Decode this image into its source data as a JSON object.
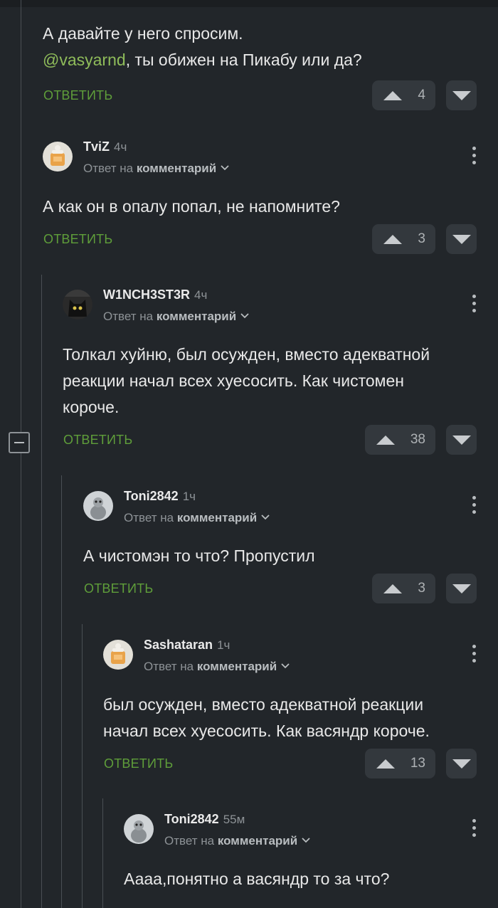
{
  "labels": {
    "reply": "ОТВЕТИТЬ",
    "reply_to": "Ответ на",
    "comment": "комментарий"
  },
  "comments": [
    {
      "body_lines": [
        "А давайте у него спросим."
      ],
      "mention": "@vasyarnd",
      "mention_tail": ", ты обижен на Пикабу или да?",
      "votes": "4"
    },
    {
      "author": "TviZ",
      "time": "4ч",
      "body": "А как он в опалу попал, не напомните?",
      "votes": "3"
    },
    {
      "author": "W1NCH3ST3R",
      "time": "4ч",
      "body": "Толкал хуйню, был осужден, вместо адекватной\nреакции начал всех хуесосить. Как чистомен\nкороче.",
      "votes": "38"
    },
    {
      "author": "Toni2842",
      "time": "1ч",
      "body": "А чистомэн то что? Пропустил",
      "votes": "3"
    },
    {
      "author": "Sashataran",
      "time": "1ч",
      "body": "был осужден, вместо адекватной реакции\nначал всех хуесосить. Как васяндр короче.",
      "votes": "13"
    },
    {
      "author": "Toni2842",
      "time": "55м",
      "body": "Аааа,понятно а васяндр то за что?",
      "votes": ""
    }
  ]
}
